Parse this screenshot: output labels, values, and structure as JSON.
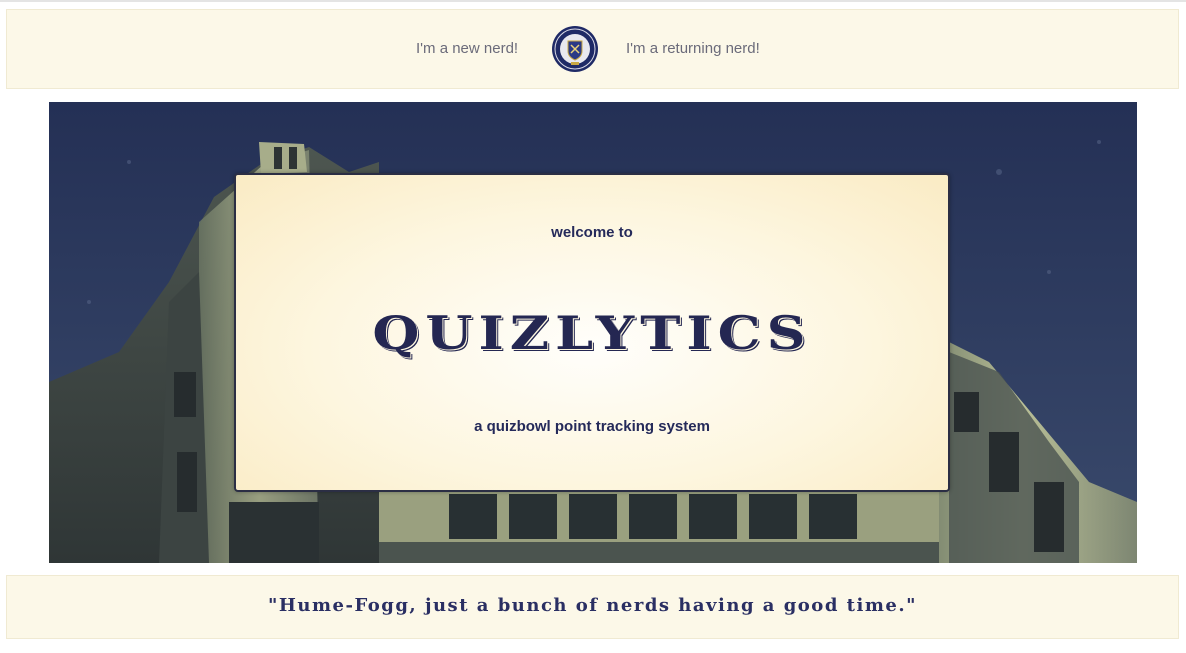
{
  "nav": {
    "new_nerd_label": "I'm a new nerd!",
    "returning_nerd_label": "I'm a returning nerd!",
    "logo_icon": "school-seal-icon"
  },
  "hero": {
    "welcome": "welcome to",
    "title": "QUIZLYTICS",
    "subtitle": "a quizbowl point tracking system"
  },
  "footer": {
    "quote": "\"Hume-Fogg, just a bunch of nerds having a good time.\""
  },
  "colors": {
    "cream": "#fcf8e8",
    "navy": "#242752",
    "nav_text": "#6b6b7a"
  }
}
